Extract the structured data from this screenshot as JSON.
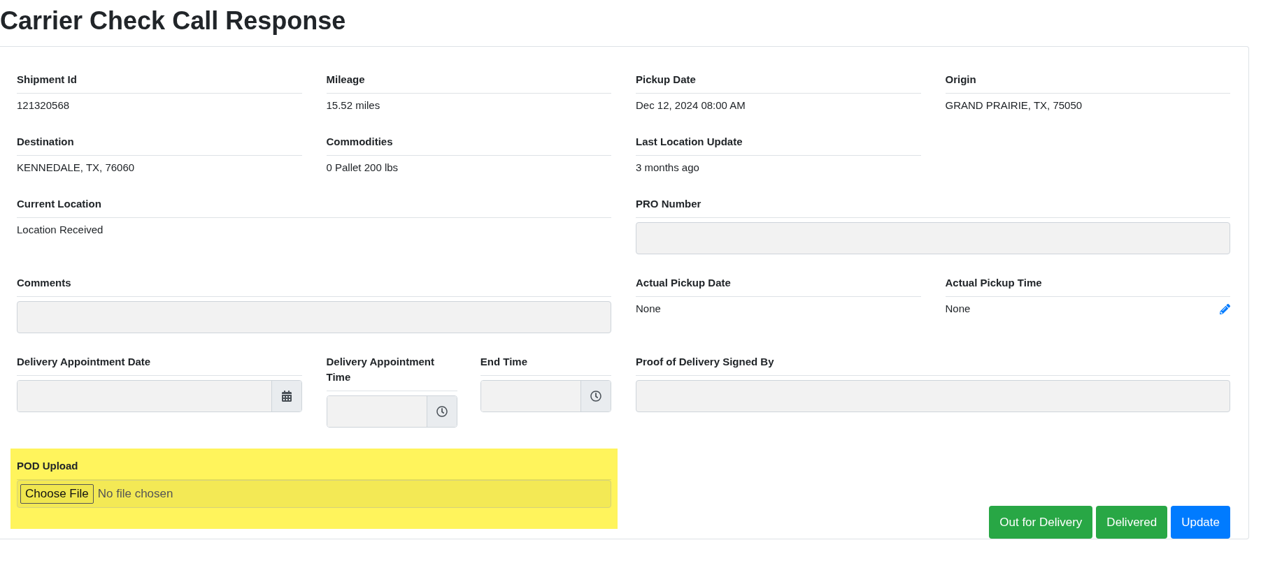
{
  "title": "Carrier Check Call Response",
  "summary": [
    {
      "label": "Shipment Id",
      "value": "121320568"
    },
    {
      "label": "Mileage",
      "value": "15.52 miles"
    },
    {
      "label": "Pickup Date",
      "value": "Dec 12, 2024 08:00 AM"
    },
    {
      "label": "Origin",
      "value": "GRAND PRAIRIE, TX, 75050"
    },
    {
      "label": "Destination",
      "value": "KENNEDALE, TX, 76060"
    },
    {
      "label": "Commodities",
      "value": "0 Pallet 200 lbs"
    },
    {
      "label": "Last Location Update",
      "value": "3 months ago"
    }
  ],
  "current_location": {
    "label": "Current Location",
    "value": "Location Received"
  },
  "pro_number": {
    "label": "PRO Number"
  },
  "comments": {
    "label": "Comments"
  },
  "actual_pickup_date": {
    "label": "Actual Pickup Date",
    "value": "None"
  },
  "actual_pickup_time": {
    "label": "Actual Pickup Time",
    "value": "None"
  },
  "delivery_appointment_date": {
    "label": "Delivery Appointment Date"
  },
  "delivery_appointment_time": {
    "label": "Delivery Appointment Time"
  },
  "end_time": {
    "label": "End Time"
  },
  "proof_of_delivery_signed_by": {
    "label": "Proof of Delivery Signed By"
  },
  "pod_upload": {
    "label": "POD Upload",
    "button": "Choose File",
    "status": "No file chosen",
    "highlighted": true
  },
  "buttons": [
    {
      "label": "Out for Delivery",
      "kind": "success"
    },
    {
      "label": "Delivered",
      "kind": "success"
    },
    {
      "label": "Update",
      "kind": "primary"
    }
  ]
}
